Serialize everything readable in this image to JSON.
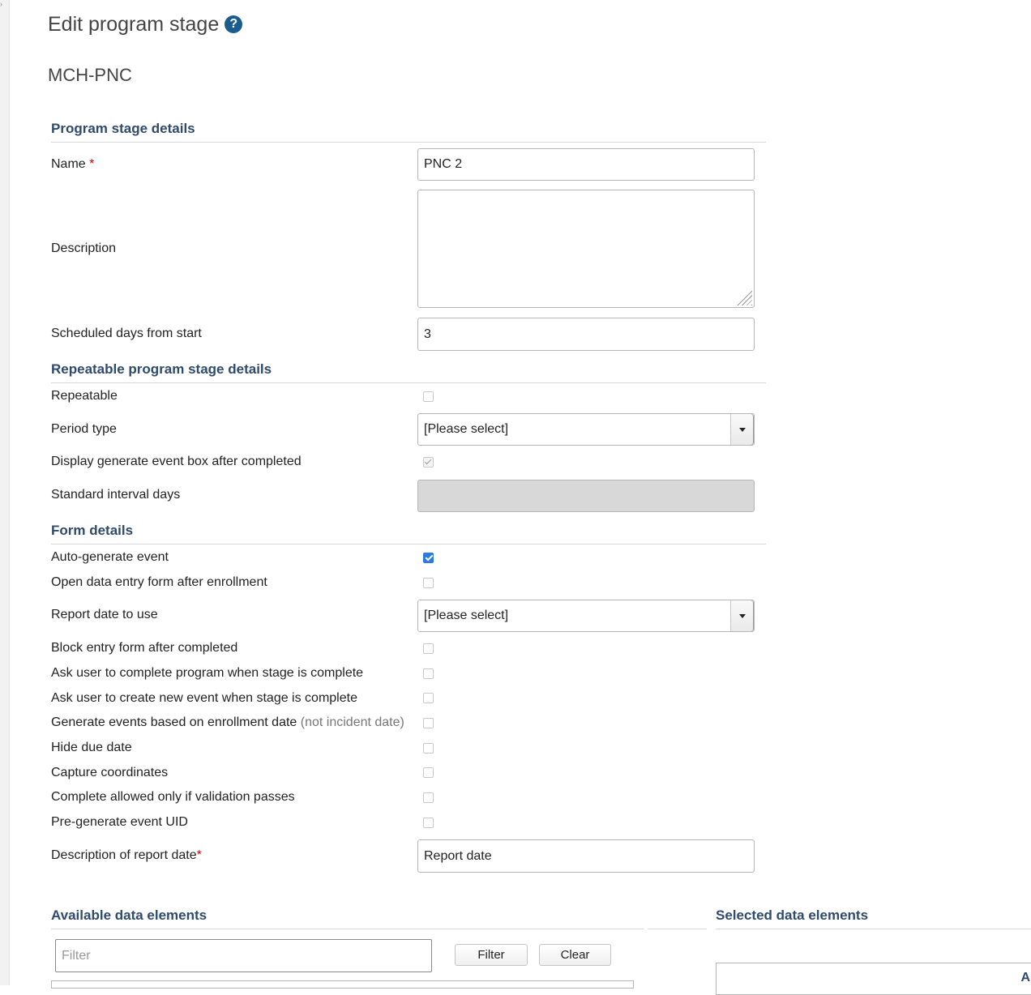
{
  "page": {
    "title": "Edit program stage",
    "program_name": "MCH-PNC"
  },
  "sections": {
    "program_stage_details": "Program stage details",
    "repeatable_details": "Repeatable program stage details",
    "form_details": "Form details",
    "available_data_elements": "Available data elements",
    "selected_data_elements": "Selected data elements"
  },
  "fields": {
    "name": {
      "label": "Name",
      "required_mark": "*",
      "value": "PNC 2"
    },
    "description": {
      "label": "Description",
      "value": ""
    },
    "scheduled_days": {
      "label": "Scheduled days from start",
      "value": "3"
    },
    "repeatable": {
      "label": "Repeatable",
      "checked": false
    },
    "period_type": {
      "label": "Period type",
      "value": "[Please select]"
    },
    "display_generate_event_box": {
      "label": "Display generate event box after completed",
      "checked": true,
      "disabled": true
    },
    "standard_interval_days": {
      "label": "Standard interval days",
      "value": "",
      "disabled": true
    },
    "auto_generate_event": {
      "label": "Auto-generate event",
      "checked": true
    },
    "open_data_entry_form": {
      "label": "Open data entry form after enrollment",
      "checked": false
    },
    "report_date_to_use": {
      "label": "Report date to use",
      "value": "[Please select]"
    },
    "block_entry_form": {
      "label": "Block entry form after completed",
      "checked": false
    },
    "ask_complete_program": {
      "label": "Ask user to complete program when stage is complete",
      "checked": false
    },
    "ask_create_new_event": {
      "label": "Ask user to create new event when stage is complete",
      "checked": false
    },
    "generate_events_enrollment": {
      "label": "Generate events based on enrollment date",
      "note": "(not incident date)",
      "checked": false
    },
    "hide_due_date": {
      "label": "Hide due date",
      "checked": false
    },
    "capture_coordinates": {
      "label": "Capture coordinates",
      "checked": false
    },
    "complete_allowed_validation": {
      "label": "Complete allowed only if validation passes",
      "checked": false
    },
    "pre_generate_uid": {
      "label": "Pre-generate event UID",
      "checked": false
    },
    "report_date_description": {
      "label": "Description of report date",
      "required_mark": "*",
      "value": "Report date"
    }
  },
  "data_elements": {
    "filter_placeholder": "Filter",
    "filter_button": "Filter",
    "clear_button": "Clear",
    "selected_list_partial_label": "A"
  }
}
